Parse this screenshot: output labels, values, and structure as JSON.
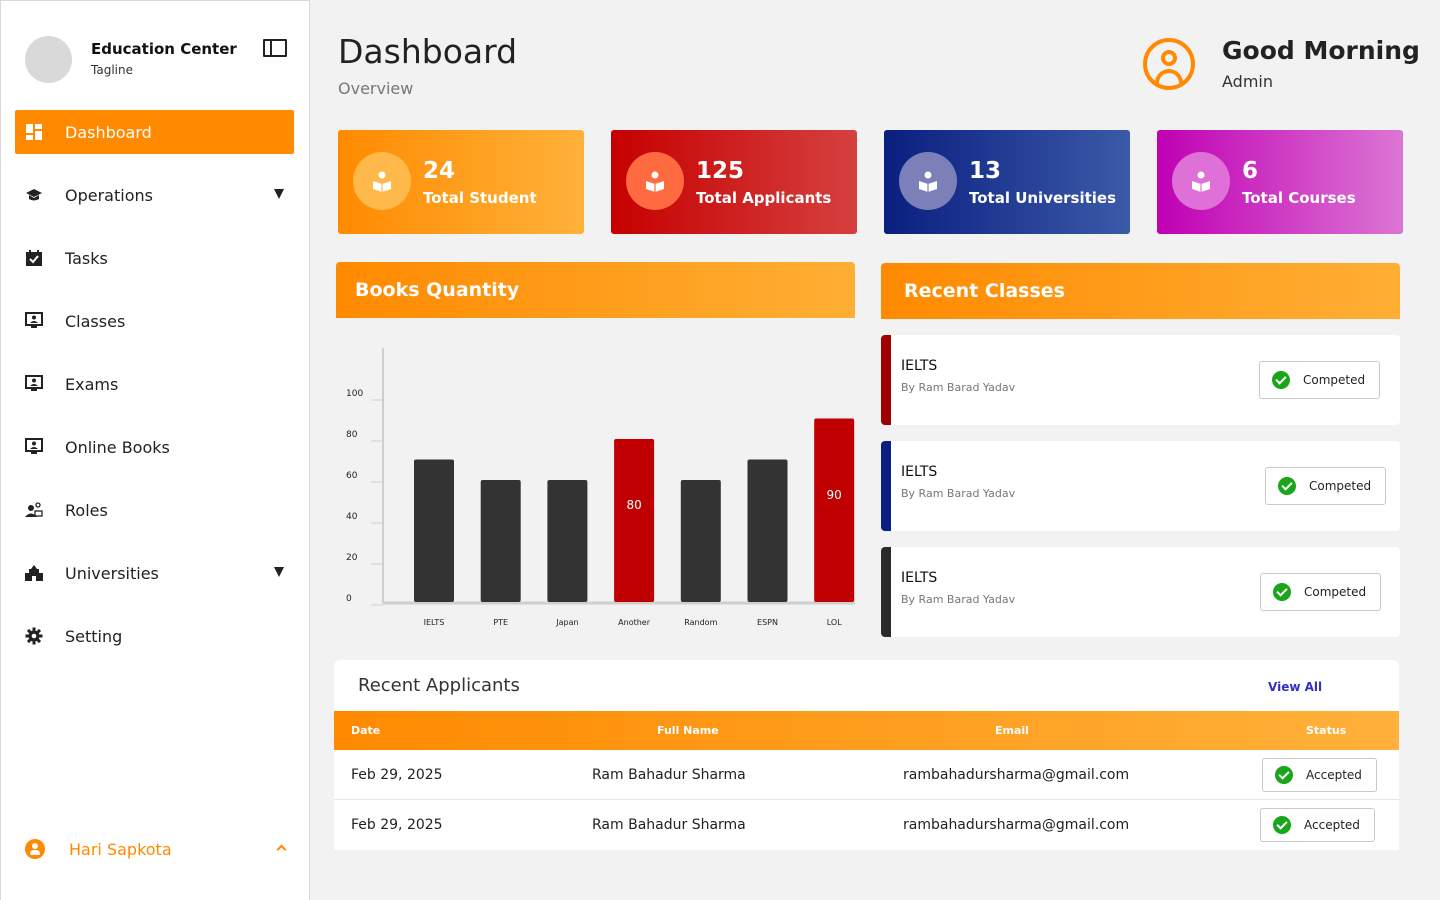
{
  "brand": {
    "name": "Education Center",
    "tagline": "Tagline"
  },
  "nav": [
    {
      "id": "dashboard",
      "label": "Dashboard",
      "active": true,
      "icon": "dashboard-icon"
    },
    {
      "id": "operations",
      "label": "Operations",
      "dropdown": true,
      "icon": "graduation-cap-icon"
    },
    {
      "id": "tasks",
      "label": "Tasks",
      "icon": "calendar-check-icon"
    },
    {
      "id": "classes",
      "label": "Classes",
      "icon": "monitor-user-icon"
    },
    {
      "id": "exams",
      "label": "Exams",
      "icon": "monitor-user-icon"
    },
    {
      "id": "online-books",
      "label": "Online Books",
      "icon": "monitor-user-icon"
    },
    {
      "id": "roles",
      "label": "Roles",
      "icon": "user-roles-icon"
    },
    {
      "id": "universities",
      "label": "Universities",
      "dropdown": true,
      "icon": "university-icon"
    },
    {
      "id": "setting",
      "label": "Setting",
      "icon": "gear-icon"
    }
  ],
  "user": {
    "name": "Hari Sapkota"
  },
  "header": {
    "title": "Dashboard",
    "subtitle": "Overview",
    "greeting": "Good Morning",
    "role": "Admin"
  },
  "stats": [
    {
      "value": "24",
      "label": "Total Student"
    },
    {
      "value": "125",
      "label": "Total Applicants"
    },
    {
      "value": "13",
      "label": "Total Universities"
    },
    {
      "value": "6",
      "label": "Total Courses"
    }
  ],
  "books": {
    "title": "Books Quantity"
  },
  "chart_data": {
    "type": "bar",
    "categories": [
      "IELTS",
      "PTE",
      "Japan",
      "Another",
      "Random",
      "ESPN",
      "LOL"
    ],
    "values": [
      70,
      60,
      60,
      80,
      60,
      70,
      90
    ],
    "highlighted": [
      false,
      false,
      false,
      true,
      false,
      false,
      true
    ],
    "data_labels": [
      "",
      "",
      "",
      "80",
      "",
      "",
      "90"
    ],
    "yticks": [
      0,
      20,
      40,
      60,
      80,
      100
    ],
    "ylim": [
      0,
      100
    ],
    "colors": {
      "default": "#333333",
      "highlight": "#c00000"
    }
  },
  "classes": {
    "title": "Recent Classes",
    "items": [
      {
        "name": "IELTS",
        "by": "By Ram Barad Yadav",
        "status": "Competed",
        "color": "#a00000"
      },
      {
        "name": "IELTS",
        "by": "By Ram Barad Yadav",
        "status": "Competed",
        "color": "#0a1f80"
      },
      {
        "name": "IELTS",
        "by": "By Ram Barad Yadav",
        "status": "Competed",
        "color": "#2a2a2a"
      }
    ]
  },
  "applicants": {
    "title": "Recent Applicants",
    "view_all": "View All",
    "columns": [
      "Date",
      "Full Name",
      "Email",
      "Status"
    ],
    "rows": [
      {
        "date": "Feb 29, 2025",
        "name": "Ram Bahadur Sharma",
        "email": "rambahadursharma@gmail.com",
        "status": "Accepted"
      },
      {
        "date": "Feb 29, 2025",
        "name": "Ram Bahadur Sharma",
        "email": "rambahadursharma@gmail.com",
        "status": "Accepted"
      }
    ]
  }
}
